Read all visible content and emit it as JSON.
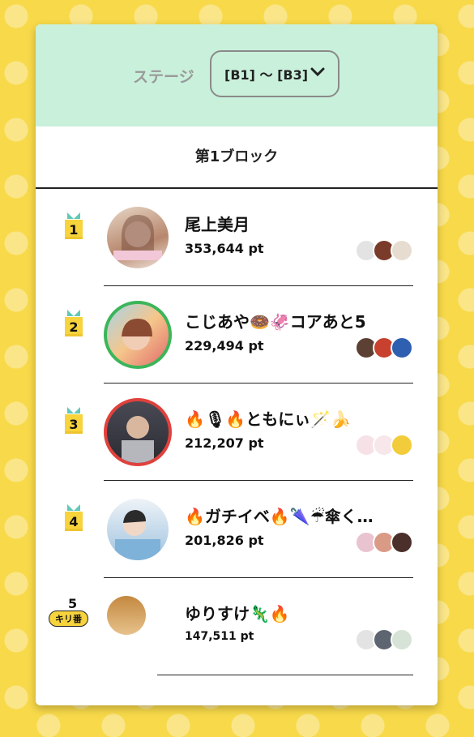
{
  "stage": {
    "label": "ステージ",
    "selected": "[B1] 〜 [B3]"
  },
  "block_title": "第1ブロック",
  "rows": [
    {
      "rank": "1",
      "name": "尾上美月",
      "points": "353,644 pt"
    },
    {
      "rank": "2",
      "name": "こじあや🍩🦑コアあと5",
      "points": "229,494 pt"
    },
    {
      "rank": "3",
      "name": "🔥🎙🔥ともにぃ🪄🍌",
      "points": "212,207 pt"
    },
    {
      "rank": "4",
      "name": "🔥ガチイベ🔥🌂☔傘く…",
      "points": "201,826 pt"
    },
    {
      "rank": "5",
      "badge": "キリ番",
      "name": "ゆりすけ🦎🔥",
      "points": "147,511 pt"
    }
  ],
  "colors": {
    "header_bg": "#c9f0db",
    "gift": "#f7d33c",
    "ring2": "#3cb55a",
    "ring3": "#e0413c"
  }
}
